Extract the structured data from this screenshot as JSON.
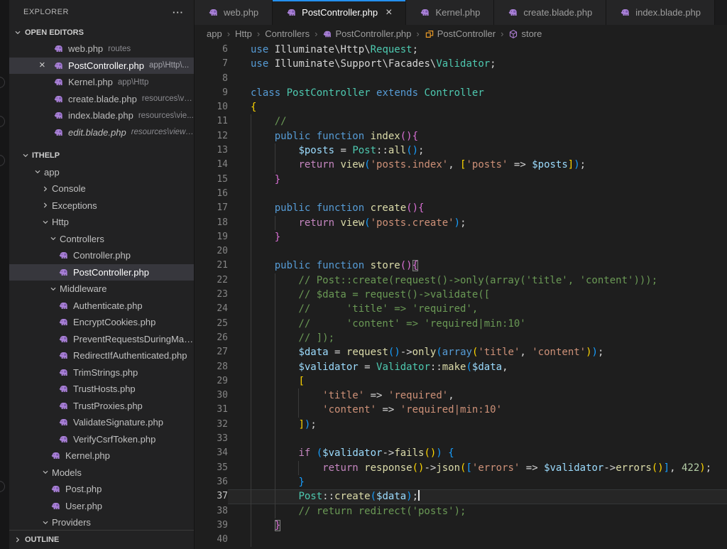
{
  "colors": {
    "editor_bg": "#1e1e1e",
    "sidebar_bg": "#222223",
    "tab_active_border": "#2490ef",
    "selection_bg": "#37373d",
    "php_icon": "#a87fd6",
    "class_icon": "#ee9d28",
    "method_icon": "#b180d7",
    "keyword": "#569CD6",
    "control": "#C586C0",
    "type": "#4EC9B0",
    "function": "#DCDCAA",
    "variable": "#9CDCFE",
    "string": "#CE9178",
    "number": "#B5CEA8",
    "comment": "#6A9955",
    "bracket_gold": "#FFD700",
    "bracket_pink": "#DA70D6",
    "bracket_blue": "#179FFF"
  },
  "sidebar": {
    "title": "EXPLORER",
    "menu_icon": "···",
    "open_editors": {
      "label": "OPEN EDITORS",
      "items": [
        {
          "name": "web.php",
          "path": "routes"
        },
        {
          "name": "PostController.php",
          "path": "app\\Http\\...",
          "selected": true,
          "close": "×"
        },
        {
          "name": "Kernel.php",
          "path": "app\\Http"
        },
        {
          "name": "create.blade.php",
          "path": "resources\\vie..."
        },
        {
          "name": "index.blade.php",
          "path": "resources\\vie..."
        },
        {
          "name": "edit.blade.php",
          "path": "resources\\views\\...",
          "italic": true
        }
      ]
    },
    "tree": [
      {
        "label": "ITHELP",
        "d": 0,
        "kind": "root",
        "exp": true
      },
      {
        "label": "app",
        "d": 1,
        "kind": "folder",
        "exp": true
      },
      {
        "label": "Console",
        "d": 2,
        "kind": "folder",
        "exp": false
      },
      {
        "label": "Exceptions",
        "d": 2,
        "kind": "folder",
        "exp": false
      },
      {
        "label": "Http",
        "d": 2,
        "kind": "folder",
        "exp": true
      },
      {
        "label": "Controllers",
        "d": 3,
        "kind": "folder",
        "exp": true
      },
      {
        "label": "Controller.php",
        "d": 4,
        "kind": "file"
      },
      {
        "label": "PostController.php",
        "d": 4,
        "kind": "file",
        "selected": true
      },
      {
        "label": "Middleware",
        "d": 3,
        "kind": "folder",
        "exp": true
      },
      {
        "label": "Authenticate.php",
        "d": 4,
        "kind": "file"
      },
      {
        "label": "EncryptCookies.php",
        "d": 4,
        "kind": "file"
      },
      {
        "label": "PreventRequestsDuringMainte...",
        "d": 4,
        "kind": "file"
      },
      {
        "label": "RedirectIfAuthenticated.php",
        "d": 4,
        "kind": "file"
      },
      {
        "label": "TrimStrings.php",
        "d": 4,
        "kind": "file"
      },
      {
        "label": "TrustHosts.php",
        "d": 4,
        "kind": "file"
      },
      {
        "label": "TrustProxies.php",
        "d": 4,
        "kind": "file"
      },
      {
        "label": "ValidateSignature.php",
        "d": 4,
        "kind": "file"
      },
      {
        "label": "VerifyCsrfToken.php",
        "d": 4,
        "kind": "file"
      },
      {
        "label": "Kernel.php",
        "d": 3,
        "kind": "file"
      },
      {
        "label": "Models",
        "d": 2,
        "kind": "folder",
        "exp": true
      },
      {
        "label": "Post.php",
        "d": 3,
        "kind": "file"
      },
      {
        "label": "User.php",
        "d": 3,
        "kind": "file"
      },
      {
        "label": "Providers",
        "d": 2,
        "kind": "folder",
        "exp": true
      }
    ],
    "outline_label": "OUTLINE"
  },
  "tabs": [
    {
      "label": "web.php",
      "active": false
    },
    {
      "label": "PostController.php",
      "active": true,
      "close": "×"
    },
    {
      "label": "Kernel.php",
      "active": false
    },
    {
      "label": "create.blade.php",
      "active": false
    },
    {
      "label": "index.blade.php",
      "active": false
    }
  ],
  "breadcrumb": [
    {
      "label": "app"
    },
    {
      "label": "Http"
    },
    {
      "label": "Controllers"
    },
    {
      "label": "PostController.php",
      "icon": "php"
    },
    {
      "label": "PostController",
      "icon": "class"
    },
    {
      "label": "store",
      "icon": "method"
    }
  ],
  "editor": {
    "lines": [
      {
        "n": 6,
        "g": [],
        "t": [
          [
            "use",
            "kw"
          ],
          [
            " Illuminate\\Http\\",
            "df"
          ],
          [
            "Request",
            "ty"
          ],
          [
            ";",
            "df"
          ]
        ]
      },
      {
        "n": 7,
        "g": [],
        "t": [
          [
            "use",
            "kw"
          ],
          [
            " Illuminate\\Support\\Facades\\",
            "df"
          ],
          [
            "Validator",
            "ty"
          ],
          [
            ";",
            "df"
          ]
        ]
      },
      {
        "n": 8,
        "g": [],
        "t": []
      },
      {
        "n": 9,
        "g": [],
        "t": [
          [
            "class",
            "kw"
          ],
          [
            " ",
            "df"
          ],
          [
            "PostController",
            "ty"
          ],
          [
            " extends ",
            "kw"
          ],
          [
            "Controller",
            "ty"
          ]
        ]
      },
      {
        "n": 10,
        "g": [],
        "t": [
          [
            "{",
            "b1"
          ]
        ]
      },
      {
        "n": 11,
        "g": [
          0
        ],
        "t": [
          [
            "    //",
            "cm"
          ]
        ]
      },
      {
        "n": 12,
        "g": [
          0
        ],
        "t": [
          [
            "    ",
            "df"
          ],
          [
            "public function ",
            "kw"
          ],
          [
            "index",
            "fn"
          ],
          [
            "(){",
            "b2"
          ]
        ]
      },
      {
        "n": 13,
        "g": [
          0,
          4
        ],
        "t": [
          [
            "        ",
            "df"
          ],
          [
            "$posts",
            "vr"
          ],
          [
            " = ",
            "df"
          ],
          [
            "Post",
            "ty"
          ],
          [
            "::",
            "df"
          ],
          [
            "all",
            "fn"
          ],
          [
            "()",
            "b3"
          ],
          [
            ";",
            "df"
          ]
        ]
      },
      {
        "n": 14,
        "g": [
          0,
          4
        ],
        "t": [
          [
            "        ",
            "df"
          ],
          [
            "return",
            "ct"
          ],
          [
            " ",
            "df"
          ],
          [
            "view",
            "fn"
          ],
          [
            "(",
            "b3"
          ],
          [
            "'posts.index'",
            "st"
          ],
          [
            ", ",
            "df"
          ],
          [
            "[",
            "b1"
          ],
          [
            "'posts'",
            "st"
          ],
          [
            " => ",
            "df"
          ],
          [
            "$posts",
            "vr"
          ],
          [
            "]",
            "b1"
          ],
          [
            ")",
            "b3"
          ],
          [
            ";",
            "df"
          ]
        ]
      },
      {
        "n": 15,
        "g": [
          0
        ],
        "t": [
          [
            "    ",
            "df"
          ],
          [
            "}",
            "b2"
          ]
        ]
      },
      {
        "n": 16,
        "g": [
          0
        ],
        "t": []
      },
      {
        "n": 17,
        "g": [
          0
        ],
        "t": [
          [
            "    ",
            "df"
          ],
          [
            "public function ",
            "kw"
          ],
          [
            "create",
            "fn"
          ],
          [
            "(){",
            "b2"
          ]
        ]
      },
      {
        "n": 18,
        "g": [
          0,
          4
        ],
        "t": [
          [
            "        ",
            "df"
          ],
          [
            "return",
            "ct"
          ],
          [
            " ",
            "df"
          ],
          [
            "view",
            "fn"
          ],
          [
            "(",
            "b3"
          ],
          [
            "'posts.create'",
            "st"
          ],
          [
            ")",
            "b3"
          ],
          [
            ";",
            "df"
          ]
        ]
      },
      {
        "n": 19,
        "g": [
          0
        ],
        "t": [
          [
            "    ",
            "df"
          ],
          [
            "}",
            "b2"
          ]
        ]
      },
      {
        "n": 20,
        "g": [
          0
        ],
        "t": []
      },
      {
        "n": 21,
        "g": [
          0
        ],
        "t": [
          [
            "    ",
            "df"
          ],
          [
            "public function ",
            "kw"
          ],
          [
            "store",
            "fn"
          ],
          [
            "()",
            "b2"
          ],
          [
            "{",
            "b2 bm"
          ]
        ]
      },
      {
        "n": 22,
        "g": [
          0,
          4
        ],
        "t": [
          [
            "        // Post::create(request()->only(array('title', 'content')));",
            "cm"
          ]
        ]
      },
      {
        "n": 23,
        "g": [
          0,
          4
        ],
        "t": [
          [
            "        // $data = request()->validate([",
            "cm"
          ]
        ]
      },
      {
        "n": 24,
        "g": [
          0,
          4
        ],
        "t": [
          [
            "        //      'title' => 'required',",
            "cm"
          ]
        ]
      },
      {
        "n": 25,
        "g": [
          0,
          4
        ],
        "t": [
          [
            "        //      'content' => 'required|min:10'",
            "cm"
          ]
        ]
      },
      {
        "n": 26,
        "g": [
          0,
          4
        ],
        "t": [
          [
            "        // ]);",
            "cm"
          ]
        ]
      },
      {
        "n": 27,
        "g": [
          0,
          4
        ],
        "t": [
          [
            "        ",
            "df"
          ],
          [
            "$data",
            "vr"
          ],
          [
            " = ",
            "df"
          ],
          [
            "request",
            "fn"
          ],
          [
            "()",
            "b3"
          ],
          [
            "->",
            "df"
          ],
          [
            "only",
            "fn"
          ],
          [
            "(",
            "b3"
          ],
          [
            "array",
            "kw"
          ],
          [
            "(",
            "b1"
          ],
          [
            "'title'",
            "st"
          ],
          [
            ", ",
            "df"
          ],
          [
            "'content'",
            "st"
          ],
          [
            ")",
            "b1"
          ],
          [
            ")",
            "b3"
          ],
          [
            ";",
            "df"
          ]
        ]
      },
      {
        "n": 28,
        "g": [
          0,
          4
        ],
        "t": [
          [
            "        ",
            "df"
          ],
          [
            "$validator",
            "vr"
          ],
          [
            " = ",
            "df"
          ],
          [
            "Validator",
            "ty"
          ],
          [
            "::",
            "df"
          ],
          [
            "make",
            "fn"
          ],
          [
            "(",
            "b3"
          ],
          [
            "$data",
            "vr"
          ],
          [
            ",",
            "df"
          ]
        ]
      },
      {
        "n": 29,
        "g": [
          0,
          4
        ],
        "t": [
          [
            "        ",
            "df"
          ],
          [
            "[",
            "b1"
          ]
        ]
      },
      {
        "n": 30,
        "g": [
          0,
          4,
          8
        ],
        "t": [
          [
            "            ",
            "df"
          ],
          [
            "'title'",
            "st"
          ],
          [
            " => ",
            "df"
          ],
          [
            "'required'",
            "st"
          ],
          [
            ",",
            "df"
          ]
        ]
      },
      {
        "n": 31,
        "g": [
          0,
          4,
          8
        ],
        "t": [
          [
            "            ",
            "df"
          ],
          [
            "'content'",
            "st"
          ],
          [
            " => ",
            "df"
          ],
          [
            "'required|min:10'",
            "st"
          ]
        ]
      },
      {
        "n": 32,
        "g": [
          0,
          4
        ],
        "t": [
          [
            "        ",
            "df"
          ],
          [
            "]",
            "b1"
          ],
          [
            ")",
            "b3"
          ],
          [
            ";",
            "df"
          ]
        ]
      },
      {
        "n": 33,
        "g": [
          0,
          4
        ],
        "t": []
      },
      {
        "n": 34,
        "g": [
          0,
          4
        ],
        "t": [
          [
            "        ",
            "df"
          ],
          [
            "if",
            "ct"
          ],
          [
            " ",
            "df"
          ],
          [
            "(",
            "b3"
          ],
          [
            "$validator",
            "vr"
          ],
          [
            "->",
            "df"
          ],
          [
            "fails",
            "fn"
          ],
          [
            "()",
            "b1"
          ],
          [
            ")",
            "b3"
          ],
          [
            " ",
            "df"
          ],
          [
            "{",
            "b3"
          ]
        ]
      },
      {
        "n": 35,
        "g": [
          0,
          4,
          8
        ],
        "t": [
          [
            "            ",
            "df"
          ],
          [
            "return",
            "ct"
          ],
          [
            " ",
            "df"
          ],
          [
            "response",
            "fn"
          ],
          [
            "()",
            "b1"
          ],
          [
            "->",
            "df"
          ],
          [
            "json",
            "fn"
          ],
          [
            "(",
            "b1"
          ],
          [
            "[",
            "b3"
          ],
          [
            "'errors'",
            "st"
          ],
          [
            " => ",
            "df"
          ],
          [
            "$validator",
            "vr"
          ],
          [
            "->",
            "df"
          ],
          [
            "errors",
            "fn"
          ],
          [
            "()",
            "b1"
          ],
          [
            "]",
            "b3"
          ],
          [
            ", ",
            "df"
          ],
          [
            "422",
            "nm"
          ],
          [
            ")",
            "b1"
          ],
          [
            ";",
            "df"
          ]
        ]
      },
      {
        "n": 36,
        "g": [
          0,
          4
        ],
        "t": [
          [
            "        ",
            "df"
          ],
          [
            "}",
            "b3"
          ]
        ]
      },
      {
        "n": 37,
        "g": [
          0,
          4
        ],
        "current": true,
        "cursor": true,
        "t": [
          [
            "        ",
            "df"
          ],
          [
            "Post",
            "ty"
          ],
          [
            "::",
            "df"
          ],
          [
            "create",
            "fn"
          ],
          [
            "(",
            "b3"
          ],
          [
            "$data",
            "vr"
          ],
          [
            ")",
            "b3"
          ],
          [
            ";",
            "df"
          ]
        ]
      },
      {
        "n": 38,
        "g": [
          0,
          4
        ],
        "t": [
          [
            "        // return redirect('posts');",
            "cm"
          ]
        ]
      },
      {
        "n": 39,
        "g": [
          0
        ],
        "t": [
          [
            "    ",
            "df"
          ],
          [
            "}",
            "b2 bm"
          ]
        ]
      },
      {
        "n": 40,
        "g": [
          0
        ],
        "t": []
      }
    ]
  }
}
